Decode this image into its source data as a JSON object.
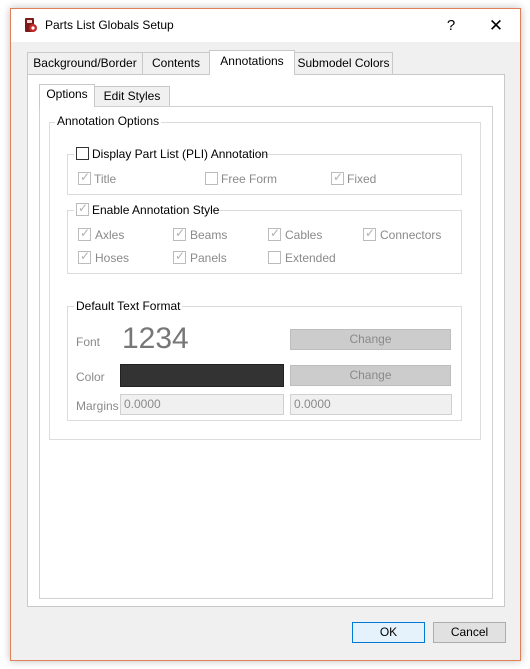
{
  "window": {
    "title": "Parts List Globals Setup",
    "help_glyph": "?",
    "close_glyph": "✕"
  },
  "tabs": [
    "Background/Border",
    "Contents",
    "Annotations",
    "Submodel Colors"
  ],
  "subtabs": [
    "Options",
    "Edit Styles"
  ],
  "annotation_options": {
    "title": "Annotation Options",
    "display_pli": {
      "label": "Display Part List (PLI) Annotation",
      "checked": false
    },
    "pli_types": [
      {
        "label": "Title",
        "checked": true
      },
      {
        "label": "Free Form",
        "checked": false
      },
      {
        "label": "Fixed",
        "checked": true
      }
    ],
    "enable_style": {
      "label": "Enable Annotation Style",
      "checked": true
    },
    "styles": [
      {
        "label": "Axles",
        "checked": true
      },
      {
        "label": "Beams",
        "checked": true
      },
      {
        "label": "Cables",
        "checked": true
      },
      {
        "label": "Connectors",
        "checked": true
      },
      {
        "label": "Hoses",
        "checked": true
      },
      {
        "label": "Panels",
        "checked": true
      },
      {
        "label": "Extended",
        "checked": false
      }
    ]
  },
  "text_format": {
    "title": "Default Text Format",
    "font_label": "Font",
    "font_sample": "1234",
    "font_change": "Change",
    "color_label": "Color",
    "color_value": "#333333",
    "color_change": "Change",
    "margins_label": "Margins",
    "margin_x": "0.0000",
    "margin_y": "0.0000"
  },
  "buttons": {
    "ok": "OK",
    "cancel": "Cancel"
  }
}
